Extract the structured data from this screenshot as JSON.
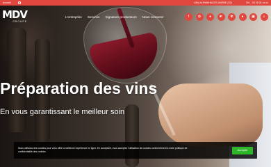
{
  "topbar": {
    "account": "Accueil",
    "phone": "Liffol-le-Petit/HAUTE-MARNE (52)",
    "email": "Tél. : 03 25 01 xx xx"
  },
  "logo": {
    "text": "MDV",
    "sub": "GROUPE"
  },
  "nav": {
    "items": [
      "L'entreprise",
      "Services",
      "Signature producteurs",
      "Nous contacter"
    ]
  },
  "social": {
    "icons": [
      "facebook-icon",
      "grape-icon",
      "bottle-icon",
      "hand-icon",
      "vine-icon",
      "location-icon",
      "truck-icon",
      "search-icon",
      "user-icon"
    ],
    "glyphs": [
      "f",
      "✿",
      "♦",
      "☛",
      "✾",
      "●",
      "▣",
      "⌕",
      "☺"
    ]
  },
  "hero": {
    "headline": "Préparation des vins",
    "subline": "En vous garantissant le meilleur soin"
  },
  "cookie": {
    "text": "Nous utilisons des cookies pour vous offrir la meilleure expérience en ligne. En acceptant, vous acceptez l'utilisation de cookies conformément à notre politique de confidentialité des cookies.",
    "accept_label": "Accepter"
  },
  "colors": {
    "accent": "#e0483f",
    "accept": "#2fb52a"
  }
}
